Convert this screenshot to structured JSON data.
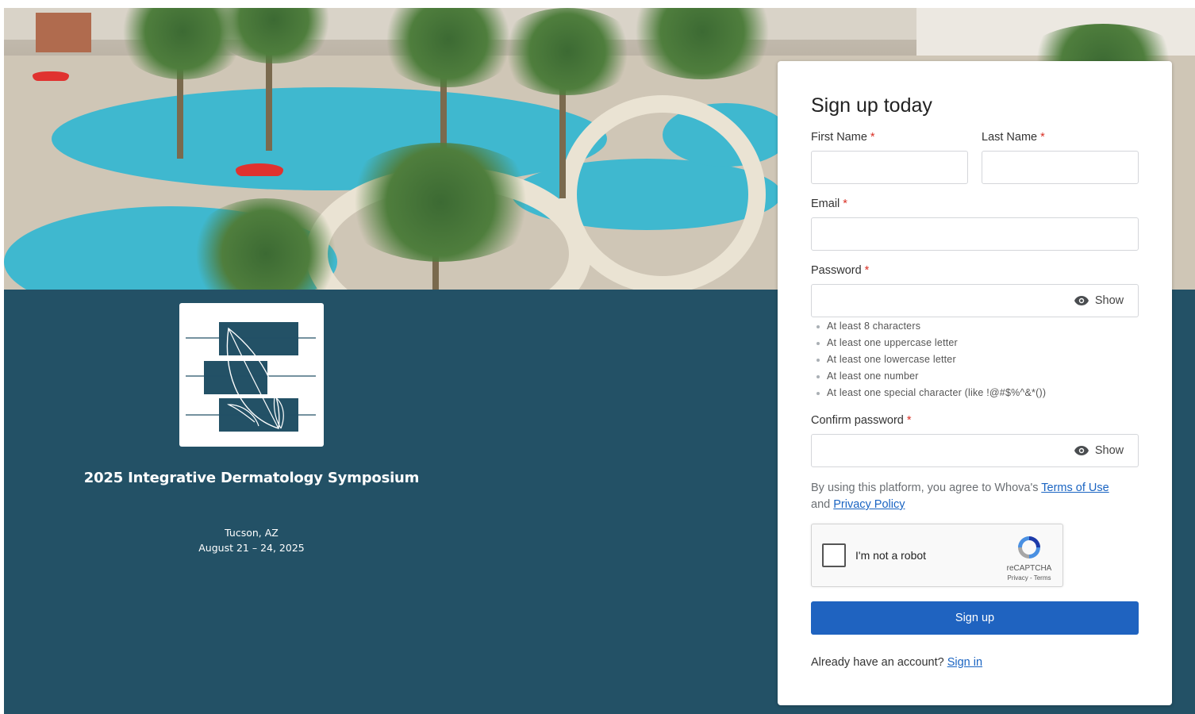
{
  "event": {
    "title": "2025 Integrative Dermatology Symposium",
    "location": "Tucson, AZ",
    "dates": "August 21 – 24, 2025"
  },
  "form": {
    "title": "Sign up today",
    "first_name_label": "First Name",
    "last_name_label": "Last Name",
    "email_label": "Email",
    "password_label": "Password",
    "confirm_password_label": "Confirm password",
    "required_mark": "*",
    "show_label": "Show",
    "first_name_value": "",
    "last_name_value": "",
    "email_value": "",
    "password_value": "",
    "confirm_password_value": "",
    "password_rules": [
      "At least 8 characters",
      "At least one uppercase letter",
      "At least one lowercase letter",
      "At least one number",
      "At least one special character (like !@#$%^&*())"
    ],
    "terms_prefix": "By using this platform, you agree to Whova's",
    "terms_link": "Terms of Use",
    "terms_and": "and",
    "privacy_link": "Privacy Policy",
    "captcha_label": "I'm not a robot",
    "captcha_brand": "reCAPTCHA",
    "captcha_privacy": "Privacy",
    "captcha_sep": "-",
    "captcha_terms": "Terms",
    "submit_label": "Sign up",
    "signin_prompt": "Already have an account?",
    "signin_link": "Sign in"
  },
  "colors": {
    "page_background": "#235166",
    "primary_button": "#1f63c0",
    "link": "#1a64c2",
    "required": "#d93025"
  },
  "icons": [
    "eye-icon",
    "recaptcha-icon",
    "symposium-logo"
  ]
}
